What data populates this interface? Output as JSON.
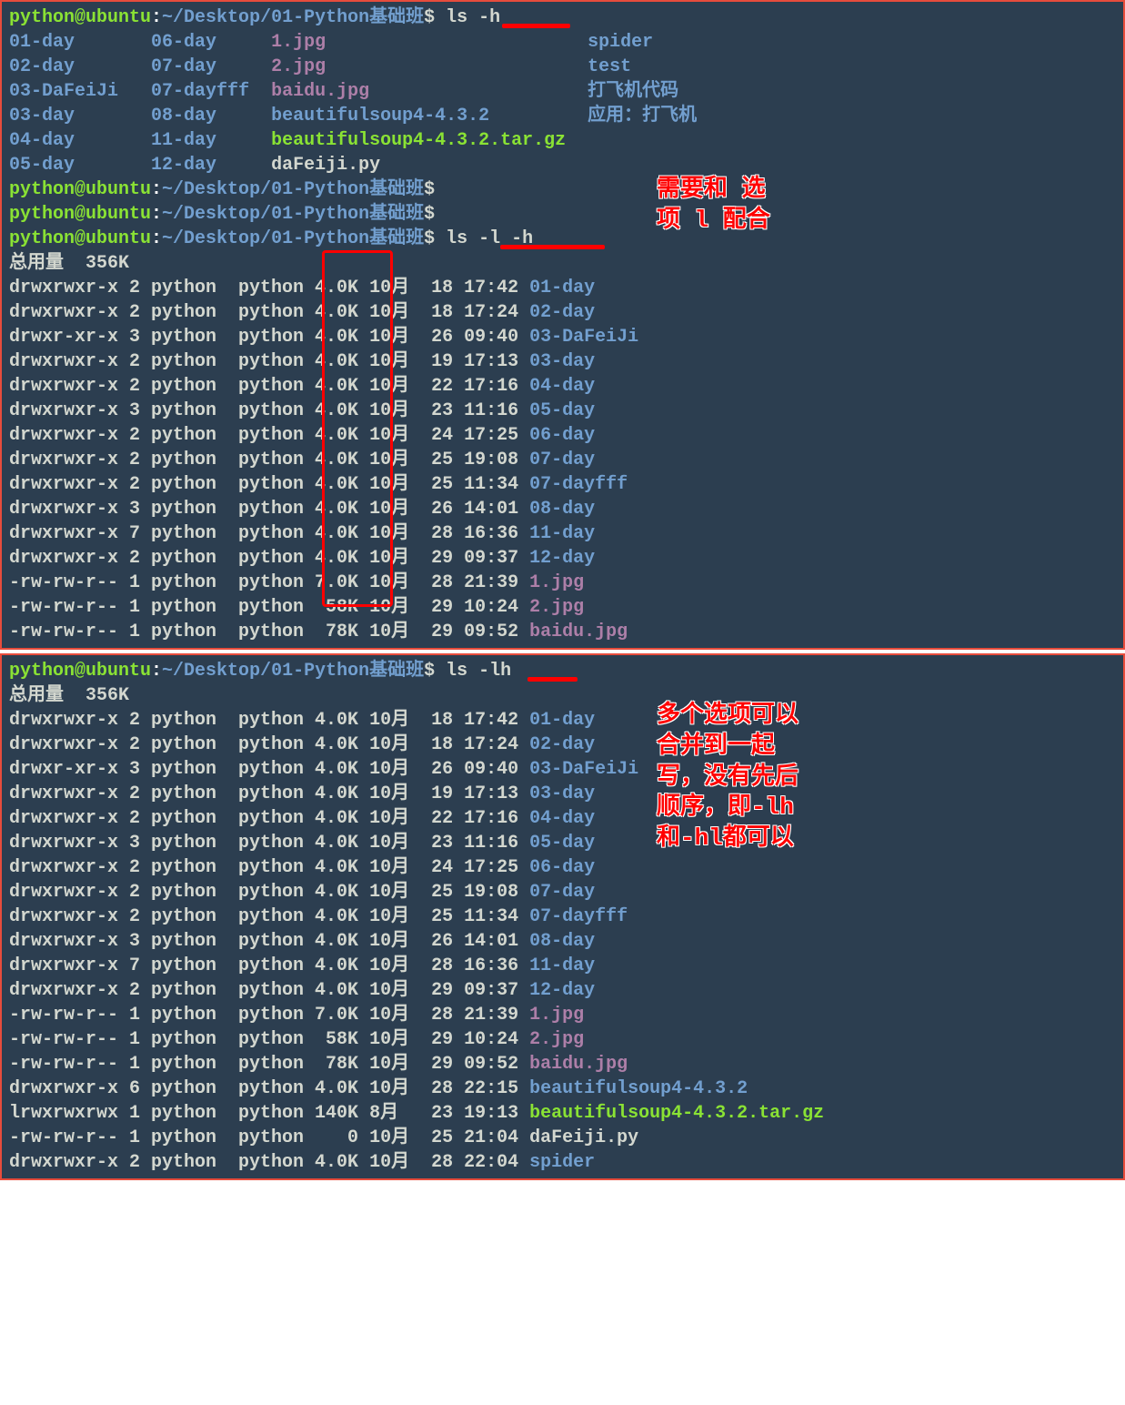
{
  "prompt": {
    "user": "python@ubuntu",
    "sep": ":",
    "path": "~/Desktop/01-Python基础班",
    "dollar": "$"
  },
  "cmd1": "ls -h",
  "cmd2": "ls -l -h",
  "cmd3": "ls -lh",
  "annotations": {
    "top": "需要和 选\n项 l 配合",
    "bottom": "多个选项可以\n合并到一起\n写，没有先后\n顺序，即-lh\n和-hl都可以"
  },
  "ls_columns": {
    "c1": [
      "01-day",
      "02-day",
      "03-DaFeiJi",
      "03-day",
      "04-day",
      "05-day"
    ],
    "c2": [
      "06-day",
      "07-day",
      "07-dayfff",
      "08-day",
      "11-day",
      "12-day"
    ],
    "c3": [
      "1.jpg",
      "2.jpg",
      "baidu.jpg",
      "beautifulsoup4-4.3.2",
      "beautifulsoup4-4.3.2.tar.gz",
      "daFeiji.py"
    ],
    "c4": [
      "spider",
      "test",
      "打飞机代码",
      "应用：打飞机"
    ]
  },
  "total": "总用量  356K",
  "listing": [
    {
      "perm": "drwxrwxr-x",
      "links": "2",
      "owner": "python",
      "group": "python",
      "size": "4.0K",
      "month": "10月",
      "day": "18",
      "time": "17:42",
      "name": "01-day",
      "cls": "dir"
    },
    {
      "perm": "drwxrwxr-x",
      "links": "2",
      "owner": "python",
      "group": "python",
      "size": "4.0K",
      "month": "10月",
      "day": "18",
      "time": "17:24",
      "name": "02-day",
      "cls": "dir"
    },
    {
      "perm": "drwxr-xr-x",
      "links": "3",
      "owner": "python",
      "group": "python",
      "size": "4.0K",
      "month": "10月",
      "day": "26",
      "time": "09:40",
      "name": "03-DaFeiJi",
      "cls": "dir"
    },
    {
      "perm": "drwxrwxr-x",
      "links": "2",
      "owner": "python",
      "group": "python",
      "size": "4.0K",
      "month": "10月",
      "day": "19",
      "time": "17:13",
      "name": "03-day",
      "cls": "dir"
    },
    {
      "perm": "drwxrwxr-x",
      "links": "2",
      "owner": "python",
      "group": "python",
      "size": "4.0K",
      "month": "10月",
      "day": "22",
      "time": "17:16",
      "name": "04-day",
      "cls": "dir"
    },
    {
      "perm": "drwxrwxr-x",
      "links": "3",
      "owner": "python",
      "group": "python",
      "size": "4.0K",
      "month": "10月",
      "day": "23",
      "time": "11:16",
      "name": "05-day",
      "cls": "dir"
    },
    {
      "perm": "drwxrwxr-x",
      "links": "2",
      "owner": "python",
      "group": "python",
      "size": "4.0K",
      "month": "10月",
      "day": "24",
      "time": "17:25",
      "name": "06-day",
      "cls": "dir"
    },
    {
      "perm": "drwxrwxr-x",
      "links": "2",
      "owner": "python",
      "group": "python",
      "size": "4.0K",
      "month": "10月",
      "day": "25",
      "time": "19:08",
      "name": "07-day",
      "cls": "dir"
    },
    {
      "perm": "drwxrwxr-x",
      "links": "2",
      "owner": "python",
      "group": "python",
      "size": "4.0K",
      "month": "10月",
      "day": "25",
      "time": "11:34",
      "name": "07-dayfff",
      "cls": "dir"
    },
    {
      "perm": "drwxrwxr-x",
      "links": "3",
      "owner": "python",
      "group": "python",
      "size": "4.0K",
      "month": "10月",
      "day": "26",
      "time": "14:01",
      "name": "08-day",
      "cls": "dir"
    },
    {
      "perm": "drwxrwxr-x",
      "links": "7",
      "owner": "python",
      "group": "python",
      "size": "4.0K",
      "month": "10月",
      "day": "28",
      "time": "16:36",
      "name": "11-day",
      "cls": "dir"
    },
    {
      "perm": "drwxrwxr-x",
      "links": "2",
      "owner": "python",
      "group": "python",
      "size": "4.0K",
      "month": "10月",
      "day": "29",
      "time": "09:37",
      "name": "12-day",
      "cls": "dir"
    },
    {
      "perm": "-rw-rw-r--",
      "links": "1",
      "owner": "python",
      "group": "python",
      "size": "7.0K",
      "month": "10月",
      "day": "28",
      "time": "21:39",
      "name": "1.jpg",
      "cls": "magenta"
    },
    {
      "perm": "-rw-rw-r--",
      "links": "1",
      "owner": "python",
      "group": "python",
      "size": " 58K",
      "month": "10月",
      "day": "29",
      "time": "10:24",
      "name": "2.jpg",
      "cls": "magenta"
    },
    {
      "perm": "-rw-rw-r--",
      "links": "1",
      "owner": "python",
      "group": "python",
      "size": " 78K",
      "month": "10月",
      "day": "29",
      "time": "09:52",
      "name": "baidu.jpg",
      "cls": "magenta"
    }
  ],
  "listing2_extra": [
    {
      "perm": "drwxrwxr-x",
      "links": "6",
      "owner": "python",
      "group": "python",
      "size": "4.0K",
      "month": "10月",
      "day": "28",
      "time": "22:15",
      "name": "beautifulsoup4-4.3.2",
      "cls": "dir"
    },
    {
      "perm": "lrwxrwxrwx",
      "links": "1",
      "owner": "python",
      "group": "python",
      "size": "140K",
      "month": "8月 ",
      "day": "23",
      "time": "19:13",
      "name": "beautifulsoup4-4.3.2.tar.gz",
      "cls": "archive"
    },
    {
      "perm": "-rw-rw-r--",
      "links": "1",
      "owner": "python",
      "group": "python",
      "size": "   0",
      "month": "10月",
      "day": "25",
      "time": "21:04",
      "name": "daFeiji.py",
      "cls": "file"
    },
    {
      "perm": "drwxrwxr-x",
      "links": "2",
      "owner": "python",
      "group": "python",
      "size": "4.0K",
      "month": "10月",
      "day": "28",
      "time": "22:04",
      "name": "spider",
      "cls": "dir"
    }
  ]
}
